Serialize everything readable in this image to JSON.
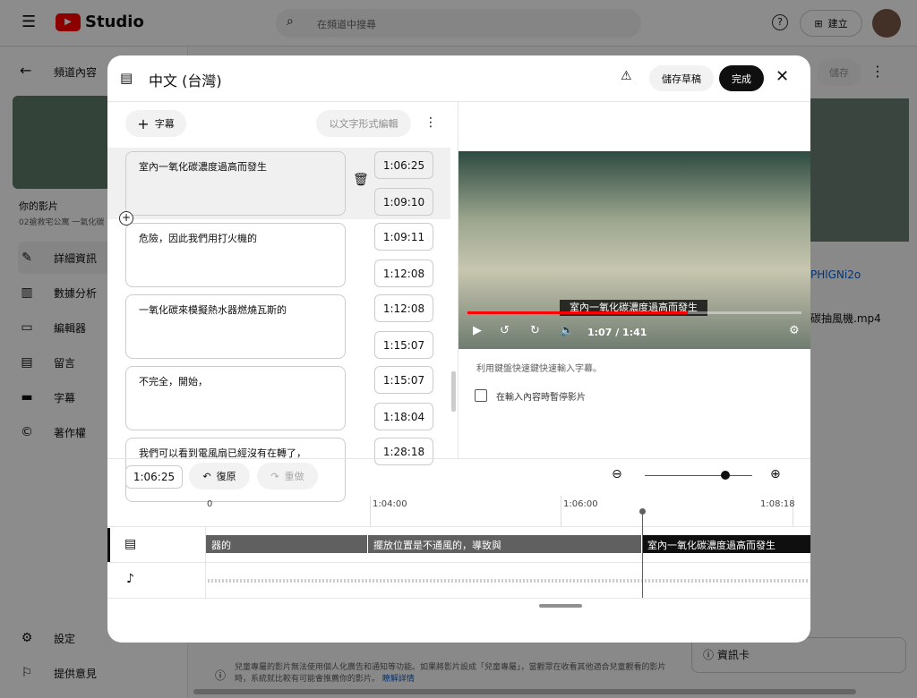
{
  "topbar": {
    "logo_text": "Studio",
    "search_placeholder": "在頻道中搜尋",
    "create_label": "建立"
  },
  "sidebar": {
    "back_label": "頻道內容",
    "video_heading": "你的影片",
    "video_title": "02搶救宅公寓 一氧化碳",
    "items": [
      {
        "label": "詳細資訊",
        "icon": "pencil-icon"
      },
      {
        "label": "數據分析",
        "icon": "analytics-icon"
      },
      {
        "label": "編輯器",
        "icon": "editor-icon"
      },
      {
        "label": "留言",
        "icon": "comments-icon"
      },
      {
        "label": "字幕",
        "icon": "subtitles-icon"
      },
      {
        "label": "著作權",
        "icon": "copyright-icon"
      }
    ],
    "settings_label": "設定",
    "feedback_label": "提供意見"
  },
  "background": {
    "save_label": "儲存",
    "link_text": "PHlGNi2o",
    "filename": "碳抽風機.mp4",
    "info_cards_label": "資訊卡",
    "notice": "兒童專屬的影片無法使用個人化廣告和通知等功能。如果將影片設成「兒童專屬」，當觀眾在收看其他適合兒童觀看的影片時，系統就比較有可能會推薦你的影片。",
    "learn_more": "瞭解詳情"
  },
  "modal": {
    "title": "中文 (台灣)",
    "save_draft_label": "儲存草稿",
    "done_label": "完成",
    "add_caption_label": "字幕",
    "edit_as_text_label": "以文字形式編輯",
    "cues": [
      {
        "text": "室內一氧化碳濃度過高而發生",
        "start": "1:06:25",
        "end": "1:09:10"
      },
      {
        "text": "危險，因此我們用打火機的",
        "start": "1:09:11",
        "end": "1:12:08"
      },
      {
        "text": "一氧化碳來模擬熱水器燃燒瓦斯的",
        "start": "1:12:08",
        "end": "1:15:07"
      },
      {
        "text": "不完全，開始，",
        "start": "1:15:07",
        "end": "1:18:04"
      },
      {
        "text": "我們可以看到電風扇已經沒有在轉了，",
        "start": "1:28:18"
      }
    ],
    "player": {
      "caption": "室內一氧化碳濃度過高而發生",
      "time": "1:07 / 1:41",
      "progress": 0.66
    },
    "shortcut_hint": "利用鍵盤快速鍵快速輸入字幕。",
    "pause_checkbox_label": "在輸入內容時暫停影片",
    "pause_checked": false,
    "timeline": {
      "current_time": "1:06:25",
      "undo_label": "復原",
      "redo_label": "重做",
      "zoom_level": 0.75,
      "ruler": [
        "0",
        "1:04:00",
        "1:06:00",
        "1:08:18"
      ],
      "segments": [
        "器的",
        "擺放位置是不通風的，導致與",
        "室內一氧化碳濃度過高而發生"
      ]
    }
  }
}
